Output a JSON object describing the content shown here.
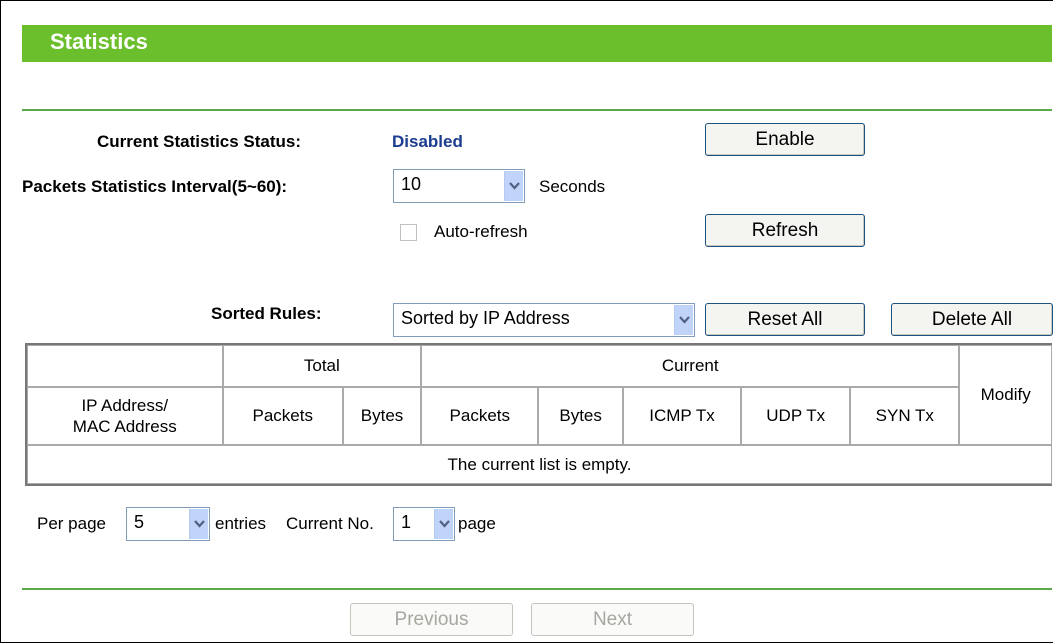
{
  "header": {
    "title": "Statistics"
  },
  "status": {
    "label": "Current Statistics Status:",
    "value": "Disabled",
    "value_color": "#1b3c8f",
    "enable_label": "Enable"
  },
  "interval": {
    "label": "Packets Statistics Interval(5~60):",
    "value": "10",
    "unit": "Seconds"
  },
  "autorefresh": {
    "label": "Auto-refresh",
    "checked": false,
    "refresh_label": "Refresh"
  },
  "sort": {
    "label": "Sorted Rules:",
    "value": "Sorted by IP Address",
    "reset_label": "Reset All",
    "delete_label": "Delete All"
  },
  "table": {
    "group_total": "Total",
    "group_current": "Current",
    "modify": "Modify",
    "col_address": "IP Address/\nMAC Address",
    "cols": [
      "Packets",
      "Bytes",
      "Packets",
      "Bytes",
      "ICMP Tx",
      "UDP Tx",
      "SYN Tx"
    ],
    "empty_message": "The current list is empty."
  },
  "paging": {
    "per_page_label": "Per page",
    "per_page_value": "5",
    "entries_label": "entries",
    "current_no_label": "Current No.",
    "current_no_value": "1",
    "page_label": "page",
    "previous_label": "Previous",
    "next_label": "Next"
  },
  "colors": {
    "header_bg": "#6cbf2c",
    "rule": "#5aaa49",
    "select_arrow": "#c0d3f8"
  }
}
